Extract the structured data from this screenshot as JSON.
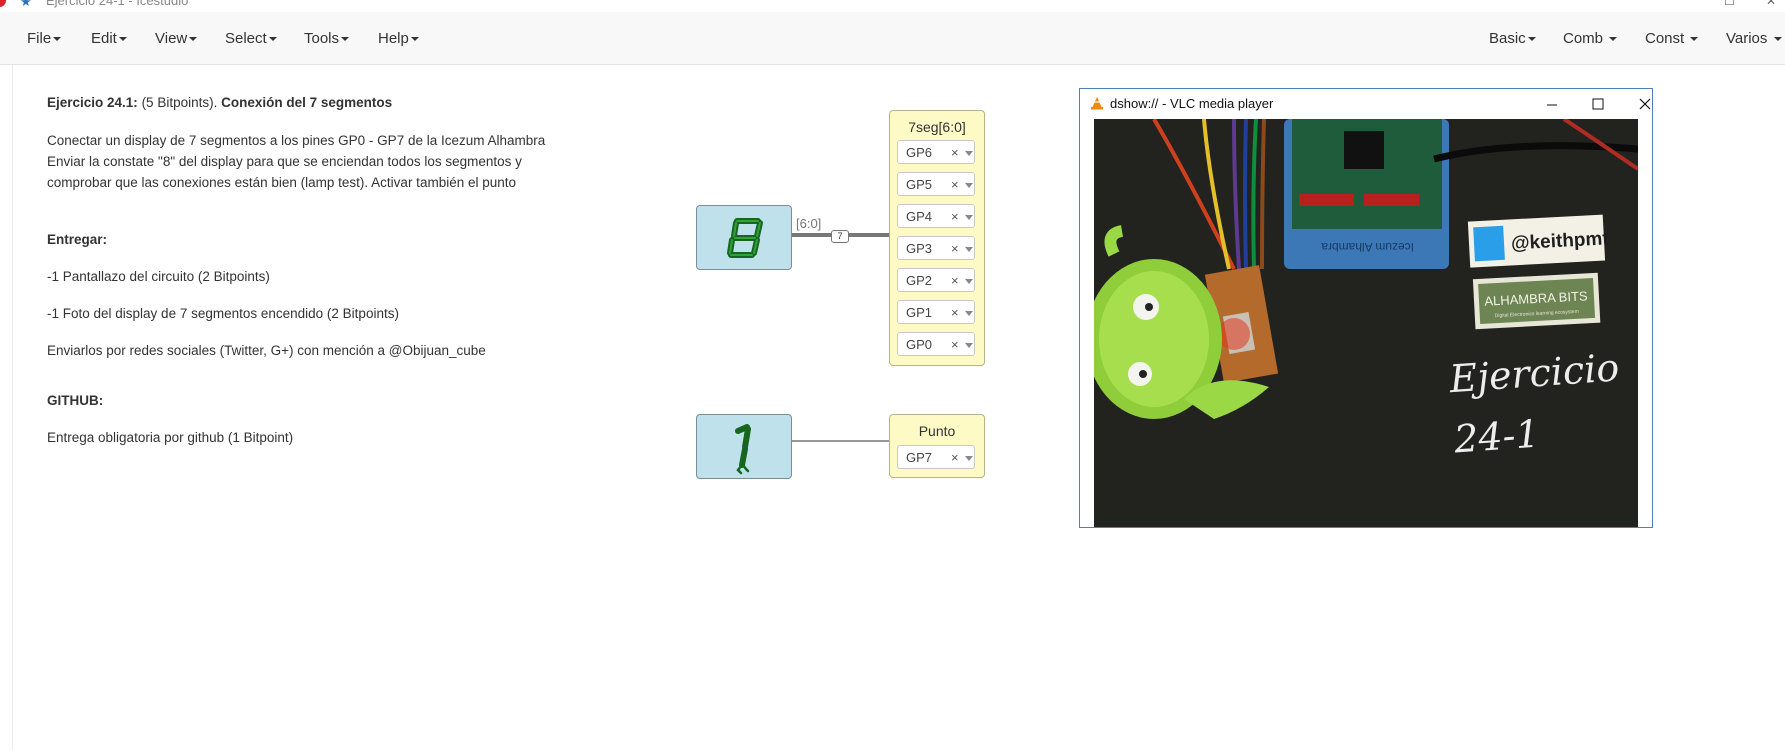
{
  "window": {
    "title": "Ejercicio 24-1 - Icestudio"
  },
  "menubar": {
    "left": [
      "File",
      "Edit",
      "View",
      "Select",
      "Tools",
      "Help"
    ],
    "right": [
      "Basic",
      "Comb",
      "Const",
      "Varios"
    ]
  },
  "content": {
    "heading_bold1": "Ejercicio 24.1:",
    "heading_normal": " (5 Bitpoints). ",
    "heading_bold2": "Conexión del 7 segmentos",
    "desc_line1": "Conectar un display de 7 segmentos a los pines GP0 - GP7 de la Icezum Alhambra",
    "desc_line2": "Enviar la constate \"8\" del display para que se enciendan todos los segmentos y",
    "desc_line3": "comprobar que las conexiones están bien (lamp test). Activar también el punto",
    "entregar_title": "Entregar:",
    "item1": "-1 Pantallazo del circuito (2 Bitpoints)",
    "item2": "-1 Foto del display de 7 segmentos encendido (2 Bitpoints)",
    "item3": "Enviarlos por redes sociales (Twitter, G+) con mención a @Obijuan_cube",
    "github_title": "GITHUB:",
    "github_item": "Entrega obligatoria por github (1 Bitpoint)"
  },
  "circuit": {
    "const1": {
      "value": "8"
    },
    "const2": {
      "value": "1"
    },
    "bus_label": "[6:0]",
    "bus_width": "7",
    "out1": {
      "title": "7seg[6:0]",
      "pins": [
        "GP6",
        "GP5",
        "GP4",
        "GP3",
        "GP2",
        "GP1",
        "GP0"
      ]
    },
    "out2": {
      "title": "Punto",
      "pins": [
        "GP7"
      ]
    },
    "remove_glyph": "×"
  },
  "vlc": {
    "title": "dshow:// - VLC media player",
    "photo_text": {
      "handle": "@keithpmt",
      "sign": "ALHAMBRA BITS",
      "sign_sub": "Digital Electronics learning ecosystem",
      "board": "Icezum Alhambra",
      "hand1": "Ejercicio",
      "hand2": "24-1"
    }
  }
}
